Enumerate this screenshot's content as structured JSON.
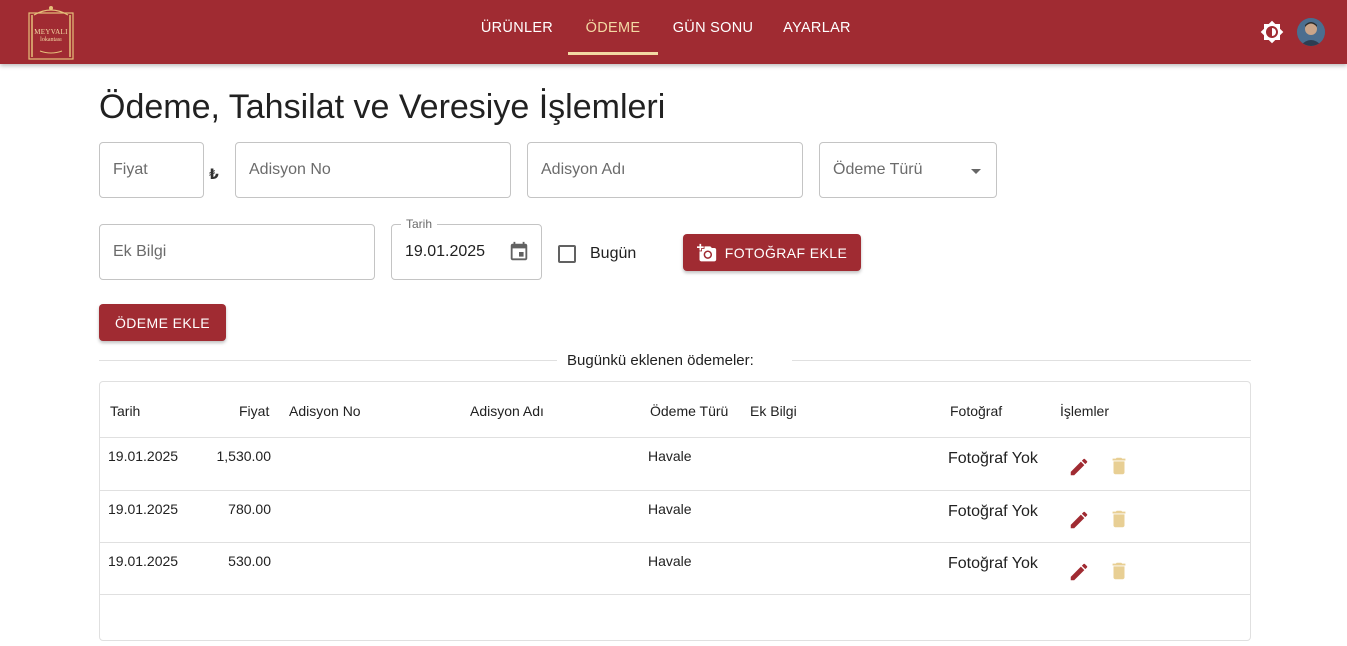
{
  "brand": {
    "logo_line1": "MEYVALI",
    "logo_line2": "lokantası"
  },
  "nav": {
    "items": [
      {
        "label": "ÜRÜNLER",
        "active": false
      },
      {
        "label": "ÖDEME",
        "active": true
      },
      {
        "label": "GÜN SONU",
        "active": false
      },
      {
        "label": "AYARLAR",
        "active": false
      }
    ]
  },
  "header": {
    "theme_icon": "brightness-icon",
    "avatar": "user-avatar"
  },
  "page": {
    "title": "Ödeme, Tahsilat ve Veresiye İşlemleri"
  },
  "form": {
    "price": {
      "placeholder": "Fiyat",
      "currency": "₺"
    },
    "receipt_no": {
      "placeholder": "Adisyon No"
    },
    "receipt_name": {
      "placeholder": "Adisyon Adı"
    },
    "payment_type": {
      "placeholder": "Ödeme Türü"
    },
    "extra_info": {
      "placeholder": "Ek Bilgi"
    },
    "date": {
      "label": "Tarih",
      "value": "19.01.2025"
    },
    "today": {
      "label": "Bugün",
      "checked": false
    },
    "add_photo_label": "FOTOĞRAF EKLE",
    "add_payment_label": "ÖDEME EKLE"
  },
  "section": {
    "divider_text": "Bugünkü eklenen ödemeler:"
  },
  "table": {
    "headers": {
      "date": "Tarih",
      "price": "Fiyat",
      "receipt_no": "Adisyon No",
      "receipt_name": "Adisyon Adı",
      "payment_type": "Ödeme Türü",
      "extra_info": "Ek Bilgi",
      "photo": "Fotoğraf",
      "actions": "İşlemler"
    },
    "rows": [
      {
        "date": "19.01.2025",
        "price": "1,530.00",
        "receipt_no": "",
        "receipt_name": "",
        "payment_type": "Havale",
        "extra_info": "",
        "photo": "Fotoğraf Yok"
      },
      {
        "date": "19.01.2025",
        "price": "780.00",
        "receipt_no": "",
        "receipt_name": "",
        "payment_type": "Havale",
        "extra_info": "",
        "photo": "Fotoğraf Yok"
      },
      {
        "date": "19.01.2025",
        "price": "530.00",
        "receipt_no": "",
        "receipt_name": "",
        "payment_type": "Havale",
        "extra_info": "",
        "photo": "Fotoğraf Yok"
      }
    ]
  },
  "colors": {
    "primary": "#a02b32",
    "accent": "#f3d9a4",
    "trash_disabled": "#e8cf94"
  }
}
